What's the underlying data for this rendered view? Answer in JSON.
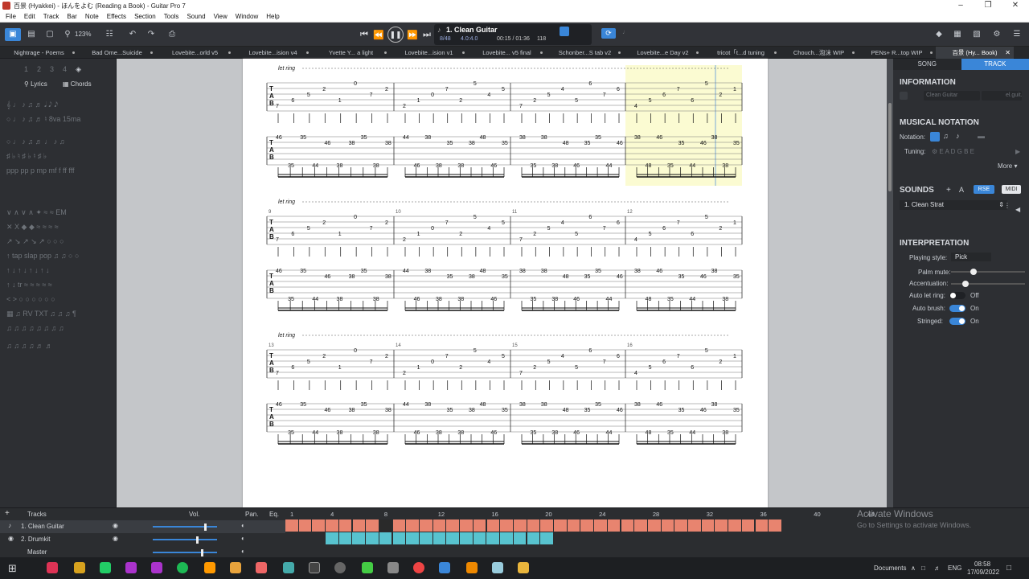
{
  "window": {
    "title": "百景 (Hyakkei) - ほんをよむ (Reading a Book) - Guitar Pro 7"
  },
  "menu": [
    "File",
    "Edit",
    "Track",
    "Bar",
    "Note",
    "Effects",
    "Section",
    "Tools",
    "Sound",
    "View",
    "Window",
    "Help"
  ],
  "toolbar": {
    "zoom": "123%"
  },
  "lcd": {
    "track": "1. Clean Guitar",
    "bar": "8/48",
    "signature": "4.0:4.0",
    "time": "00:15 / 01:36",
    "tempo": "118"
  },
  "tabs": [
    "Nightrage - Poems",
    "Bad Ome...Suicide",
    "Lovebite...orld v5",
    "Lovebite...ision v4",
    "Yvette Y... a light",
    "Lovebite...ision v1",
    "Lovebite... v5 final",
    "Schonber...S tab v2",
    "Lovebite...e Day v2",
    "tricot「t...d tuning",
    "Chouch...泡沫 WIP",
    "PENs+ R...top WIP",
    "百景 (Hy... Book)"
  ],
  "left": {
    "lyrics": "Lyrics",
    "chords": "Chords",
    "numbers": [
      "1",
      "2",
      "3",
      "4"
    ]
  },
  "score": {
    "let_ring": "let ring",
    "measure_numbers": [
      "9",
      "10",
      "11",
      "12",
      "13",
      "14",
      "15",
      "16"
    ],
    "tab_letters": [
      "T",
      "A",
      "B"
    ],
    "g1": [
      "7",
      "6",
      "5",
      "2",
      "1",
      "0",
      "7",
      "2",
      "5",
      "4",
      "5",
      "6"
    ],
    "b1": [
      "46",
      "35",
      "35",
      "44",
      "46",
      "38",
      "38",
      "35",
      "38",
      "38",
      "48"
    ]
  },
  "right": {
    "tab_song": "SONG",
    "tab_track": "TRACK",
    "information": "INFORMATION",
    "track_name_ph": "Clean Guitar",
    "instrument_ph": "el.guit.",
    "musical_notation": "MUSICAL NOTATION",
    "notation_label": "Notation:",
    "tuning_label": "Tuning:",
    "tuning_value": "E A D G B E",
    "more": "More",
    "sounds": "SOUNDS",
    "rse": "RSE",
    "midi": "MIDI",
    "sound_name": "1. Clean Strat",
    "interpretation": "INTERPRETATION",
    "playing_style_label": "Playing style:",
    "playing_style": "Pick",
    "palm_mute": "Palm mute:",
    "accentuation": "Accentuation:",
    "auto_let_ring": "Auto let ring:",
    "auto_let_ring_val": "Off",
    "auto_brush": "Auto brush:",
    "auto_brush_val": "On",
    "stringed": "Stringed:",
    "stringed_val": "On"
  },
  "trackpanel": {
    "tracks_label": "Tracks",
    "vol": "Vol.",
    "pan": "Pan.",
    "eq": "Eq.",
    "tracks": [
      "1. Clean Guitar",
      "2. Drumkit"
    ],
    "master": "Master",
    "ruler": [
      "1",
      "4",
      "8",
      "12",
      "16",
      "20",
      "24",
      "28",
      "32",
      "36",
      "40",
      "44"
    ]
  },
  "watermark": {
    "line1": "Activate Windows",
    "line2": "Go to Settings to activate Windows."
  },
  "taskbar": {
    "documents": "Documents",
    "lang": "ENG",
    "time": "08:58",
    "date": "17/09/2022"
  },
  "colors": {
    "accent": "#3a86d8",
    "guitar_block": "#e8846f",
    "drum_block": "#58c3cf",
    "highlight": "#fbfbd2"
  }
}
